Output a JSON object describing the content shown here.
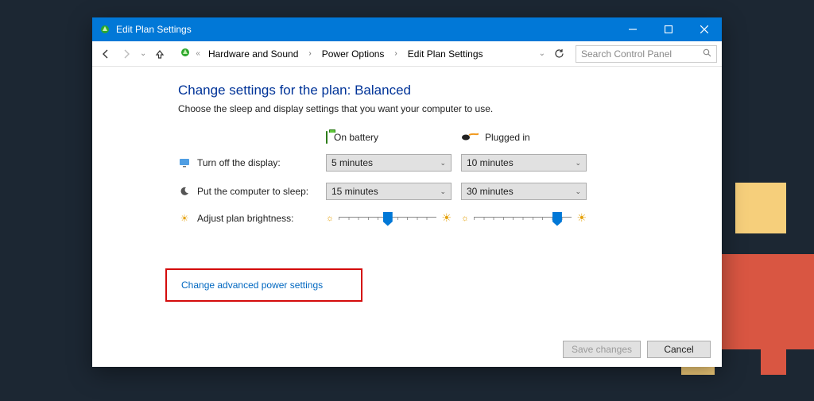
{
  "window": {
    "title": "Edit Plan Settings"
  },
  "nav": {
    "crumbs": [
      "Hardware and Sound",
      "Power Options",
      "Edit Plan Settings"
    ],
    "search_placeholder": "Search Control Panel"
  },
  "page": {
    "heading": "Change settings for the plan: Balanced",
    "sub": "Choose the sleep and display settings that you want your computer to use.",
    "col_battery": "On battery",
    "col_plugged": "Plugged in",
    "rows": {
      "display_label": "Turn off the display:",
      "display_battery": "5 minutes",
      "display_plugged": "10 minutes",
      "sleep_label": "Put the computer to sleep:",
      "sleep_battery": "15 minutes",
      "sleep_plugged": "30 minutes",
      "brightness_label": "Adjust plan brightness:"
    },
    "sliders": {
      "battery_pct": 50,
      "plugged_pct": 85
    },
    "advanced_link": "Change advanced power settings",
    "save_label": "Save changes",
    "cancel_label": "Cancel"
  }
}
